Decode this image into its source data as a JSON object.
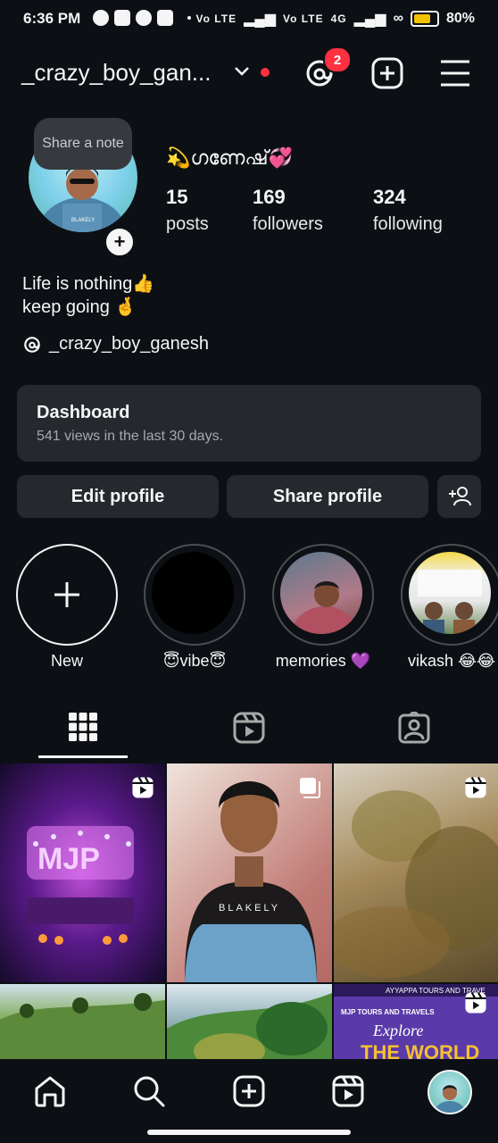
{
  "status_bar": {
    "time": "6:36 PM",
    "network_1": "Vo LTE",
    "network_2": "Vo LTE",
    "network_type": "4G",
    "battery": "80%",
    "battery_level": 0.8
  },
  "header": {
    "username": "_crazy_boy_gan...",
    "threads_badge": "2",
    "icons": [
      "threads-icon",
      "add-post-icon",
      "menu-icon"
    ]
  },
  "profile": {
    "note": "Share a note",
    "display_name": "💫ഗണേഷ്💞",
    "stats": [
      {
        "value": "15",
        "label": "posts"
      },
      {
        "value": "169",
        "label": "followers"
      },
      {
        "value": "324",
        "label": "following"
      }
    ],
    "bio_line1": "Life is nothing👍",
    "bio_line2": "keep going 🤞",
    "threads_handle": "_crazy_boy_ganesh"
  },
  "dashboard": {
    "title": "Dashboard",
    "subtitle": "541 views in the last 30 days."
  },
  "actions": {
    "edit_profile": "Edit profile",
    "share_profile": "Share profile"
  },
  "highlights": [
    {
      "label": "New"
    },
    {
      "label": "😇vibe😇"
    },
    {
      "label": "memories 💜"
    },
    {
      "label": "vikash 😂😂"
    }
  ],
  "tiles": {
    "tile3_text": "AYYAPPA TOURS AND TRAVE",
    "tile3_text2": "MJP TOURS AND TRAVELS",
    "tile3_text3": "Explore",
    "tile3_text4": "THE WORLD",
    "tile1_text": "MJP",
    "tile2_text": "BLAKELY"
  },
  "colors": {
    "background": "#0c1014",
    "card": "#25292e",
    "badge": "#ff3040",
    "battery": "#f2c200"
  }
}
